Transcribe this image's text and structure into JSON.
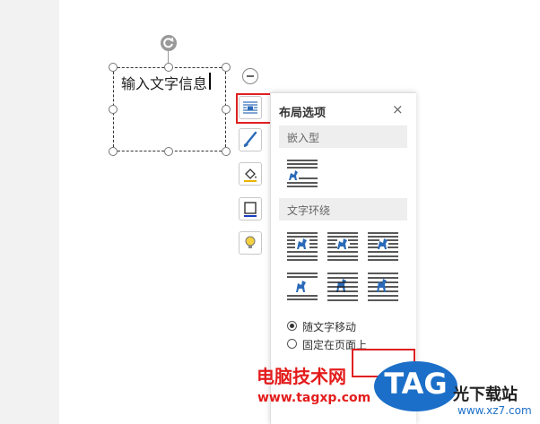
{
  "textbox": {
    "text": "输入文字信息"
  },
  "panel": {
    "title": "布局选项",
    "close_glyph": "×",
    "sections": {
      "inline": "嵌入型",
      "wrap": "文字环绕"
    },
    "radio": {
      "move_with_text": "随文字移动",
      "fix_on_page": "固定在页面上"
    }
  },
  "watermark": {
    "site_name": "电脑技术网",
    "url": "www.tagxp.com",
    "tag": "TAG",
    "download": "光下载站",
    "download_url": "www.xz7.com"
  },
  "colors": {
    "accent_blue": "#2a6ab8",
    "highlight_red": "#e02020",
    "tag_blue": "#1c6fc8"
  }
}
